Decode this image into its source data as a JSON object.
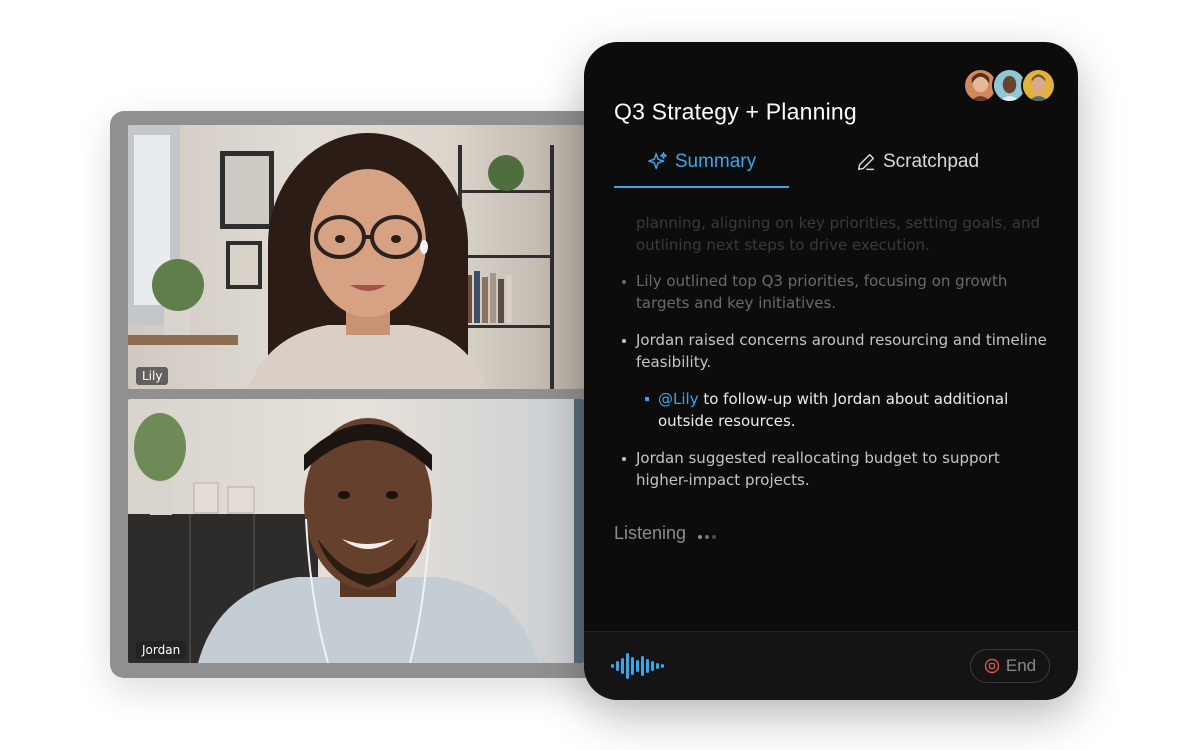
{
  "video_call": {
    "participants": [
      {
        "name": "Lily"
      },
      {
        "name": "Jordan"
      }
    ]
  },
  "panel": {
    "title": "Q3 Strategy + Planning",
    "tabs": [
      {
        "label": "Summary",
        "icon": "sparkle-icon",
        "active": true
      },
      {
        "label": "Scratchpad",
        "icon": "pencil-icon",
        "active": false
      }
    ],
    "summary": {
      "faded_intro": "planning, aligning on key priorities, setting goals, and outlining next steps to drive execution.",
      "bullets": [
        {
          "text": "Lily outlined top Q3 priorities, focusing on growth targets and key initiatives."
        },
        {
          "text": "Jordan raised concerns around resourcing and timeline feasibility."
        },
        {
          "mention": "@Lily",
          "text": " to follow-up with Jordan about additional outside resources."
        },
        {
          "text": "Jordan suggested reallocating budget to support higher-impact projects."
        }
      ]
    },
    "status": "Listening",
    "footer": {
      "end_label": "End",
      "wave_icon": "audio-wave-icon",
      "end_icon": "stop-record-icon"
    }
  },
  "colors": {
    "accent": "#3aa5e8",
    "panel_bg": "#0c0c0d",
    "frame": "#909090"
  }
}
